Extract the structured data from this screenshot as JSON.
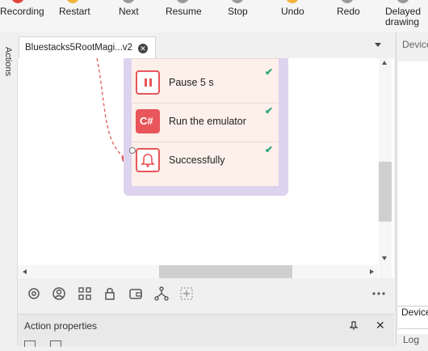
{
  "toolbar": {
    "recording": "Recording",
    "restart": "Restart",
    "next": "Next",
    "resume": "Resume",
    "stop": "Stop",
    "undo": "Undo",
    "redo": "Redo",
    "delayed_line1": "Delayed",
    "delayed_line2": "drawing"
  },
  "left_strip": {
    "actions_label": "Actions"
  },
  "tab": {
    "title": "Bluestacks5RootMagi...v2"
  },
  "canvas": {
    "steps": [
      {
        "label": "Pause 5 s",
        "icon": "pause-icon",
        "status": "done"
      },
      {
        "label": "Run the emulator",
        "icon": "csharp-icon",
        "icon_text": "C#",
        "status": "done"
      },
      {
        "label": "Successfully",
        "icon": "bell-icon",
        "status": "done"
      }
    ]
  },
  "action_properties": {
    "title": "Action properties"
  },
  "right_panel": {
    "top_tab": "Device",
    "bottom_tab": "Device",
    "log_tab": "Log"
  },
  "colors": {
    "accent_red": "#e8555a",
    "check_green": "#2aa37a",
    "group_border": "#dcd3ef",
    "step_bg": "#fdf0ea"
  }
}
